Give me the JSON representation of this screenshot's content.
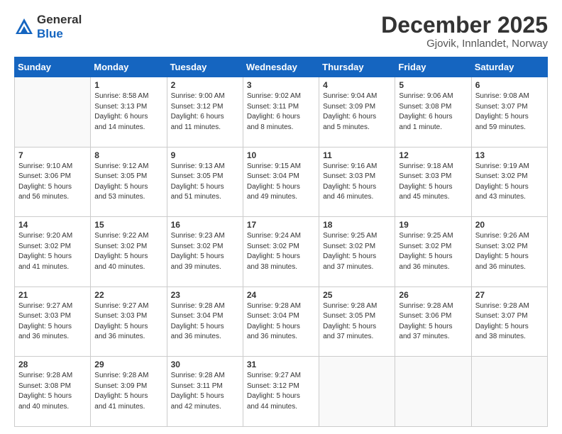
{
  "header": {
    "logo_general": "General",
    "logo_blue": "Blue",
    "month_title": "December 2025",
    "location": "Gjovik, Innlandet, Norway"
  },
  "weekdays": [
    "Sunday",
    "Monday",
    "Tuesday",
    "Wednesday",
    "Thursday",
    "Friday",
    "Saturday"
  ],
  "weeks": [
    [
      {
        "num": "",
        "info": ""
      },
      {
        "num": "1",
        "info": "Sunrise: 8:58 AM\nSunset: 3:13 PM\nDaylight: 6 hours\nand 14 minutes."
      },
      {
        "num": "2",
        "info": "Sunrise: 9:00 AM\nSunset: 3:12 PM\nDaylight: 6 hours\nand 11 minutes."
      },
      {
        "num": "3",
        "info": "Sunrise: 9:02 AM\nSunset: 3:11 PM\nDaylight: 6 hours\nand 8 minutes."
      },
      {
        "num": "4",
        "info": "Sunrise: 9:04 AM\nSunset: 3:09 PM\nDaylight: 6 hours\nand 5 minutes."
      },
      {
        "num": "5",
        "info": "Sunrise: 9:06 AM\nSunset: 3:08 PM\nDaylight: 6 hours\nand 1 minute."
      },
      {
        "num": "6",
        "info": "Sunrise: 9:08 AM\nSunset: 3:07 PM\nDaylight: 5 hours\nand 59 minutes."
      }
    ],
    [
      {
        "num": "7",
        "info": "Sunrise: 9:10 AM\nSunset: 3:06 PM\nDaylight: 5 hours\nand 56 minutes."
      },
      {
        "num": "8",
        "info": "Sunrise: 9:12 AM\nSunset: 3:05 PM\nDaylight: 5 hours\nand 53 minutes."
      },
      {
        "num": "9",
        "info": "Sunrise: 9:13 AM\nSunset: 3:05 PM\nDaylight: 5 hours\nand 51 minutes."
      },
      {
        "num": "10",
        "info": "Sunrise: 9:15 AM\nSunset: 3:04 PM\nDaylight: 5 hours\nand 49 minutes."
      },
      {
        "num": "11",
        "info": "Sunrise: 9:16 AM\nSunset: 3:03 PM\nDaylight: 5 hours\nand 46 minutes."
      },
      {
        "num": "12",
        "info": "Sunrise: 9:18 AM\nSunset: 3:03 PM\nDaylight: 5 hours\nand 45 minutes."
      },
      {
        "num": "13",
        "info": "Sunrise: 9:19 AM\nSunset: 3:02 PM\nDaylight: 5 hours\nand 43 minutes."
      }
    ],
    [
      {
        "num": "14",
        "info": "Sunrise: 9:20 AM\nSunset: 3:02 PM\nDaylight: 5 hours\nand 41 minutes."
      },
      {
        "num": "15",
        "info": "Sunrise: 9:22 AM\nSunset: 3:02 PM\nDaylight: 5 hours\nand 40 minutes."
      },
      {
        "num": "16",
        "info": "Sunrise: 9:23 AM\nSunset: 3:02 PM\nDaylight: 5 hours\nand 39 minutes."
      },
      {
        "num": "17",
        "info": "Sunrise: 9:24 AM\nSunset: 3:02 PM\nDaylight: 5 hours\nand 38 minutes."
      },
      {
        "num": "18",
        "info": "Sunrise: 9:25 AM\nSunset: 3:02 PM\nDaylight: 5 hours\nand 37 minutes."
      },
      {
        "num": "19",
        "info": "Sunrise: 9:25 AM\nSunset: 3:02 PM\nDaylight: 5 hours\nand 36 minutes."
      },
      {
        "num": "20",
        "info": "Sunrise: 9:26 AM\nSunset: 3:02 PM\nDaylight: 5 hours\nand 36 minutes."
      }
    ],
    [
      {
        "num": "21",
        "info": "Sunrise: 9:27 AM\nSunset: 3:03 PM\nDaylight: 5 hours\nand 36 minutes."
      },
      {
        "num": "22",
        "info": "Sunrise: 9:27 AM\nSunset: 3:03 PM\nDaylight: 5 hours\nand 36 minutes."
      },
      {
        "num": "23",
        "info": "Sunrise: 9:28 AM\nSunset: 3:04 PM\nDaylight: 5 hours\nand 36 minutes."
      },
      {
        "num": "24",
        "info": "Sunrise: 9:28 AM\nSunset: 3:04 PM\nDaylight: 5 hours\nand 36 minutes."
      },
      {
        "num": "25",
        "info": "Sunrise: 9:28 AM\nSunset: 3:05 PM\nDaylight: 5 hours\nand 37 minutes."
      },
      {
        "num": "26",
        "info": "Sunrise: 9:28 AM\nSunset: 3:06 PM\nDaylight: 5 hours\nand 37 minutes."
      },
      {
        "num": "27",
        "info": "Sunrise: 9:28 AM\nSunset: 3:07 PM\nDaylight: 5 hours\nand 38 minutes."
      }
    ],
    [
      {
        "num": "28",
        "info": "Sunrise: 9:28 AM\nSunset: 3:08 PM\nDaylight: 5 hours\nand 40 minutes."
      },
      {
        "num": "29",
        "info": "Sunrise: 9:28 AM\nSunset: 3:09 PM\nDaylight: 5 hours\nand 41 minutes."
      },
      {
        "num": "30",
        "info": "Sunrise: 9:28 AM\nSunset: 3:11 PM\nDaylight: 5 hours\nand 42 minutes."
      },
      {
        "num": "31",
        "info": "Sunrise: 9:27 AM\nSunset: 3:12 PM\nDaylight: 5 hours\nand 44 minutes."
      },
      {
        "num": "",
        "info": ""
      },
      {
        "num": "",
        "info": ""
      },
      {
        "num": "",
        "info": ""
      }
    ]
  ]
}
